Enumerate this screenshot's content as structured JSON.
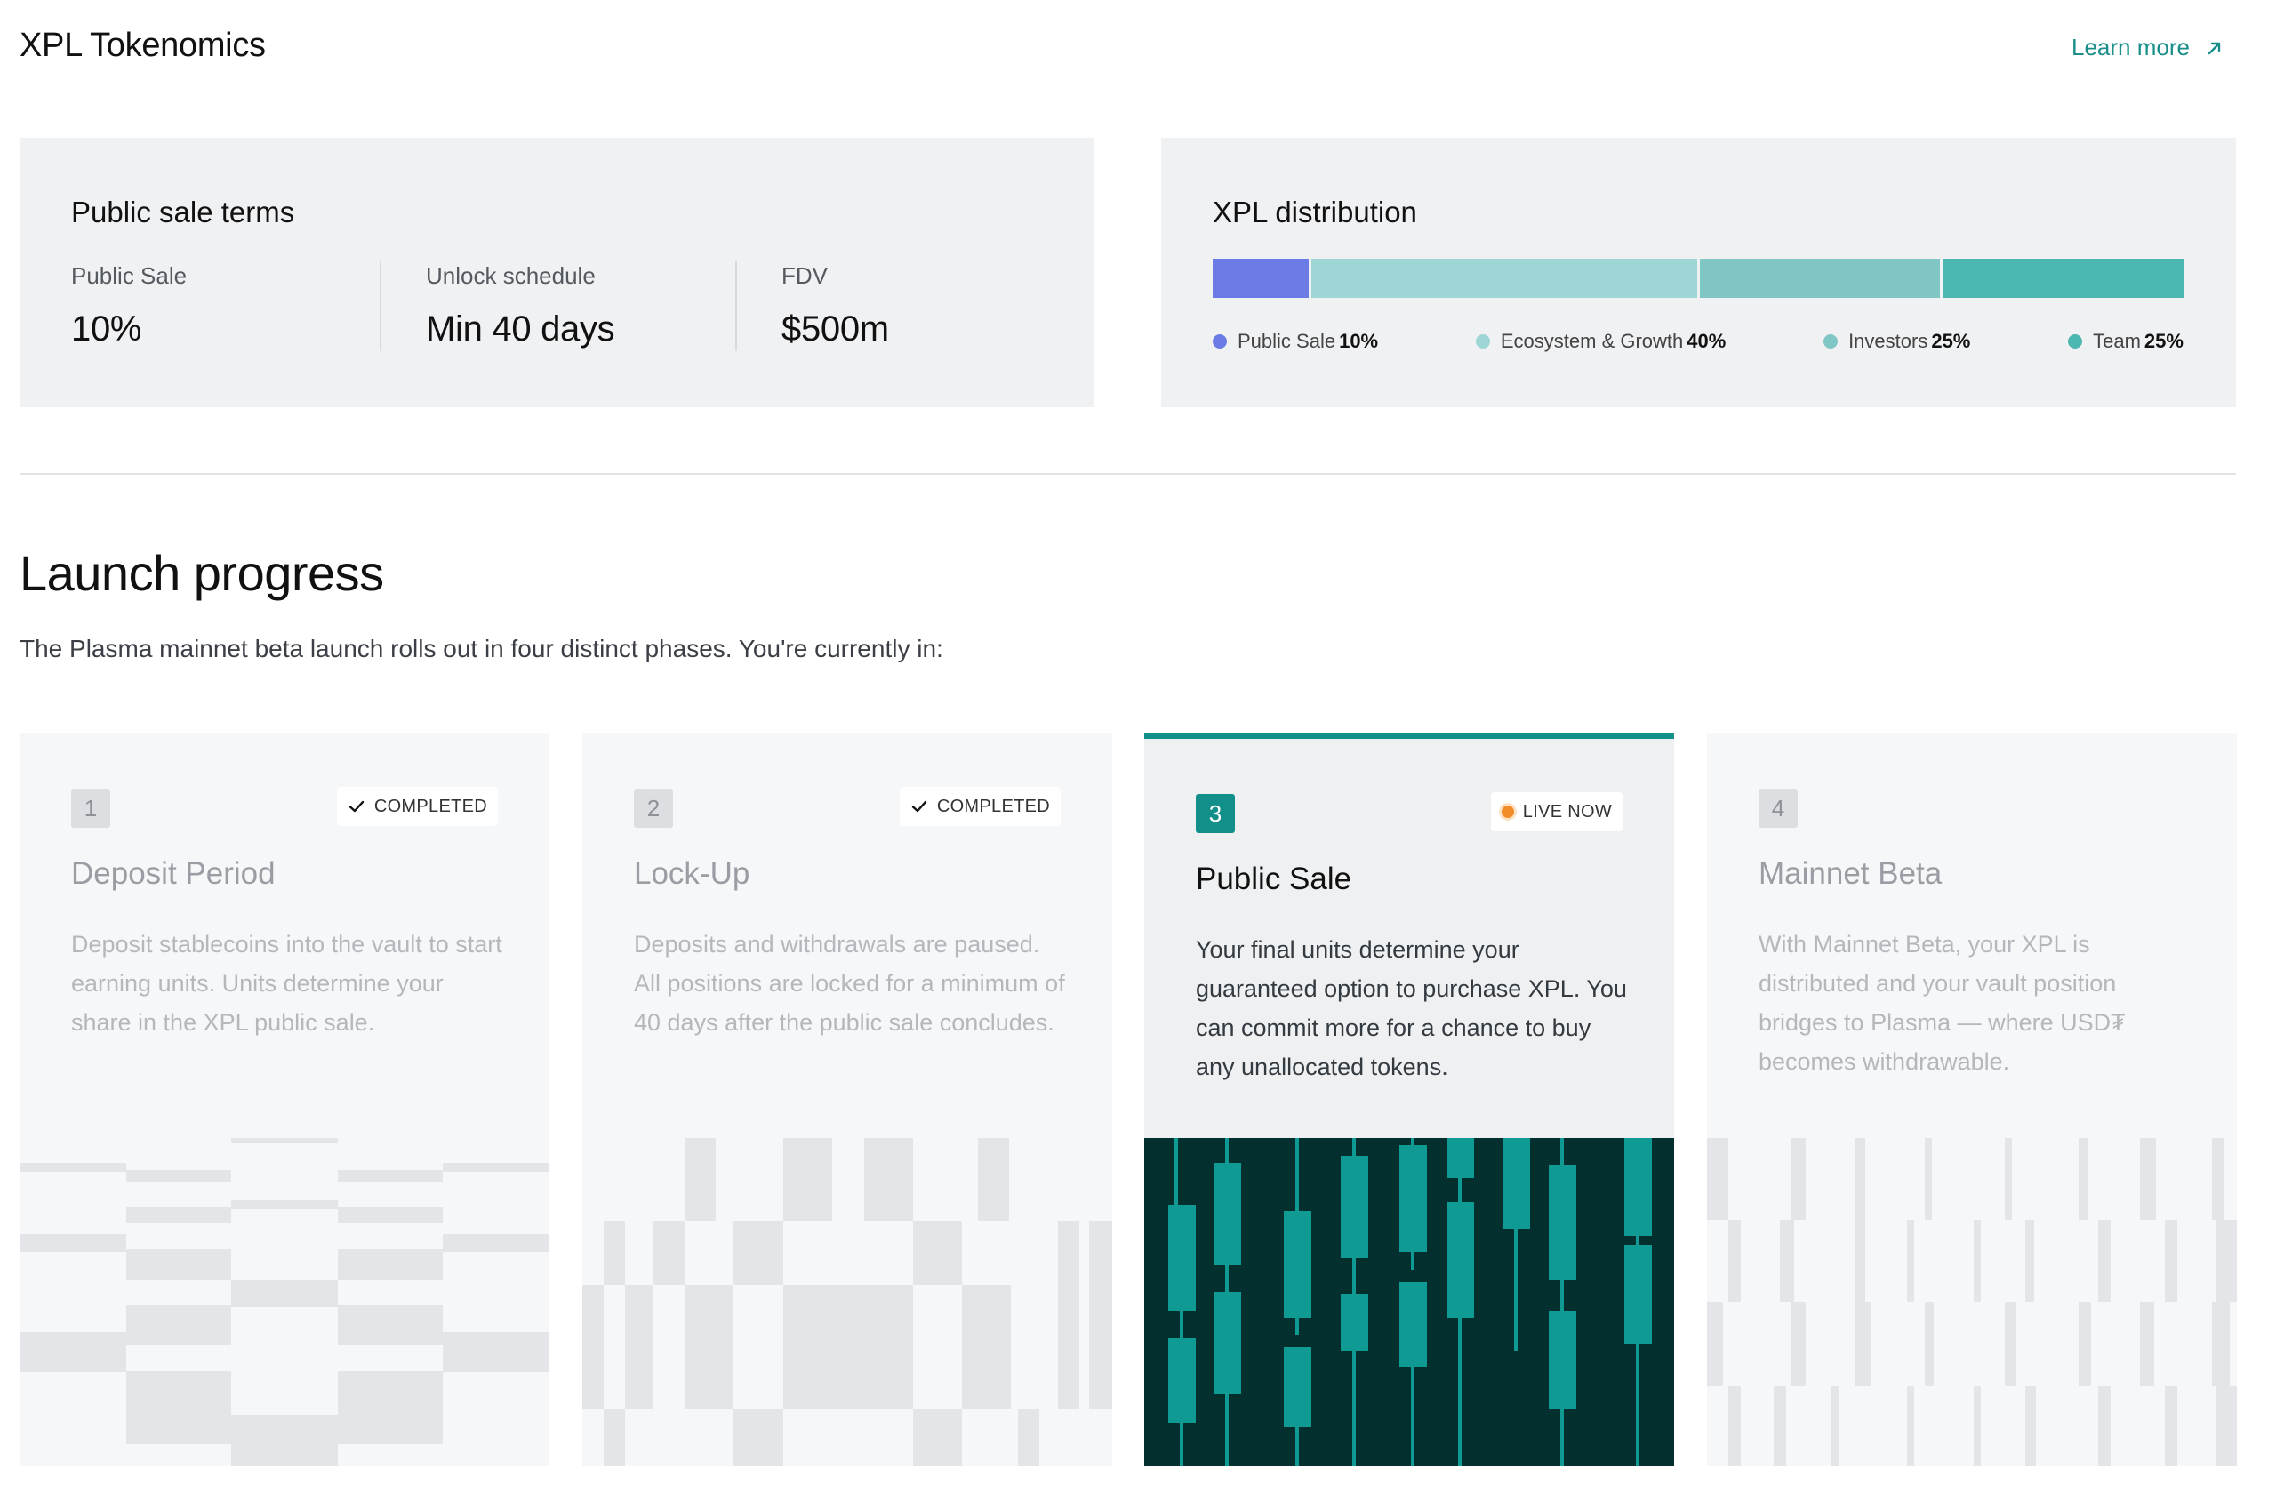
{
  "header": {
    "title": "XPL Tokenomics",
    "learn_more": "Learn more",
    "learn_more_icon": "arrow-up-right-icon"
  },
  "terms": {
    "title": "Public sale terms",
    "stats": [
      {
        "label": "Public Sale",
        "value": "10%"
      },
      {
        "label": "Unlock schedule",
        "value": "Min 40 days"
      },
      {
        "label": "FDV",
        "value": "$500m"
      }
    ]
  },
  "distribution": {
    "title": "XPL distribution",
    "segments": [
      {
        "name": "Public Sale",
        "percent_label": "10%",
        "percent": 10,
        "color": "#6a7be6"
      },
      {
        "name": "Ecosystem & Growth",
        "percent_label": "40%",
        "percent": 40,
        "color": "#9dd6d4"
      },
      {
        "name": "Investors",
        "percent_label": "25%",
        "percent": 25,
        "color": "#80c6c4"
      },
      {
        "name": "Team",
        "percent_label": "25%",
        "percent": 25,
        "color": "#4cb6b1"
      }
    ]
  },
  "launch": {
    "title": "Launch progress",
    "subtitle": "The Plasma mainnet beta launch rolls out in four distinct phases. You're currently in:",
    "phases": [
      {
        "number": "1",
        "status": "COMPLETED",
        "status_icon": "check-icon",
        "title": "Deposit Period",
        "description": "Deposit stablecoins into the vault to start earning units. Units determine your share in the XPL public sale."
      },
      {
        "number": "2",
        "status": "COMPLETED",
        "status_icon": "check-icon",
        "title": "Lock-Up",
        "description": "Deposits and withdrawals are paused. All positions are locked for a minimum of 40 days after the public sale concludes."
      },
      {
        "number": "3",
        "status": "LIVE NOW",
        "status_icon": "live-dot-icon",
        "title": "Public Sale",
        "description": "Your final units determine your guaranteed option to purchase XPL. You can commit more for a chance to buy any unallocated tokens."
      },
      {
        "number": "4",
        "status": "",
        "title": "Mainnet Beta",
        "description": "With Mainnet Beta, your XPL is distributed and your vault position bridges to Plasma — where USD₮ becomes withdrawable."
      }
    ]
  },
  "colors": {
    "accent": "#11918a",
    "panel_bg": "#f0f1f3",
    "active_pattern_bg": "#03302f",
    "active_pattern_fg": "#0f9a93",
    "live_dot": "#f28c28"
  }
}
